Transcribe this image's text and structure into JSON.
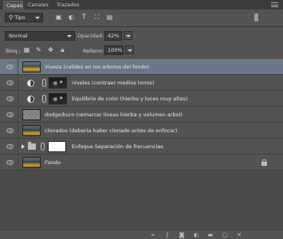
{
  "tabs": [
    {
      "label": "Capas",
      "active": true
    },
    {
      "label": "Canales",
      "active": false
    },
    {
      "label": "Trazados",
      "active": false
    }
  ],
  "filter": {
    "label": "Tipo"
  },
  "blend": {
    "mode": "Normal",
    "opacity_label": "Opacidad:",
    "opacity_value": "42%"
  },
  "lock": {
    "label": "Bloq.:",
    "fill_label": "Relleno:",
    "fill_value": "100%"
  },
  "layers": [
    {
      "name": "Viveza (calidez en los arboles del fondo)",
      "selected": true
    },
    {
      "name": "niveles (contraer medios tonos)"
    },
    {
      "name": "Equilibrio de color (hierba y luces muy altas)"
    },
    {
      "name": "dodge/burn (remarcar lineas hierba y volumen arbol)"
    },
    {
      "name": "clonados (deberia haber clonado antes de enfocar)"
    },
    {
      "name": "Enfoque Separación de frecuencias"
    },
    {
      "name": "Fondo"
    }
  ],
  "colors": {
    "panel": "#535353",
    "selected_row": "#6a7787",
    "tabstrip": "#3c3c3c"
  }
}
